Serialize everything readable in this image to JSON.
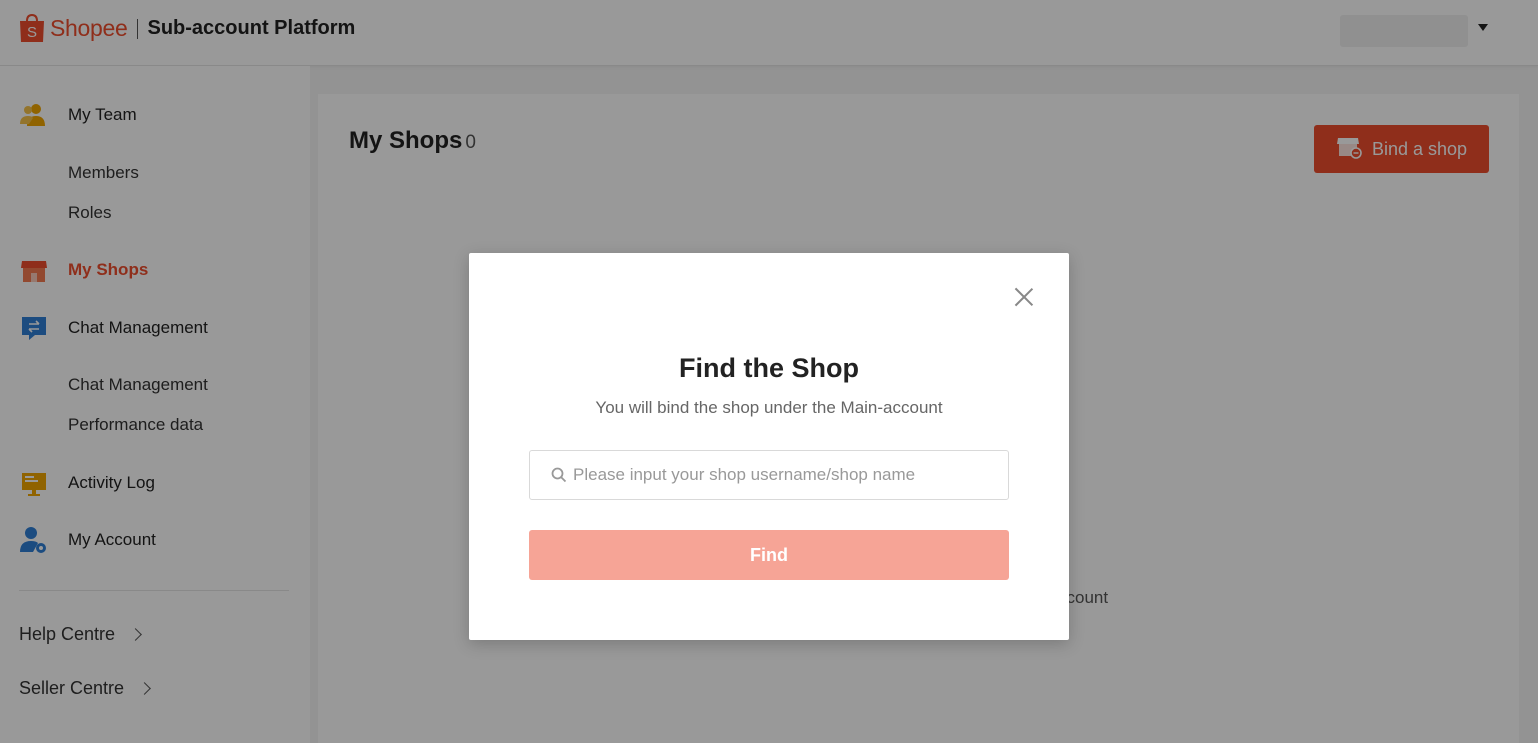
{
  "header": {
    "logo_text": "Shopee",
    "platform_name": "Sub-account Platform",
    "logo_icon": "shopee-bag-icon",
    "user_menu_icon": "caret-down-icon"
  },
  "sidebar": {
    "groups": [
      {
        "label": "My Team",
        "icon": "team-icon",
        "items": [
          "Members",
          "Roles"
        ]
      },
      {
        "label": "My Shops",
        "icon": "shop-icon",
        "active": true
      },
      {
        "label": "Chat Management",
        "icon": "chat-icon",
        "items": [
          "Chat Management",
          "Performance data"
        ]
      },
      {
        "label": "Activity Log",
        "icon": "activity-log-icon"
      },
      {
        "label": "My Account",
        "icon": "account-settings-icon"
      }
    ],
    "links": [
      "Help Centre",
      "Seller Centre"
    ]
  },
  "content": {
    "title": "My Shops",
    "count": "0",
    "bind_button": "Bind a shop",
    "empty_hint_fragment": "ccount"
  },
  "modal": {
    "title": "Find the Shop",
    "subtitle": "You will bind the shop under the Main-account",
    "search_placeholder": "Please input your shop username/shop name",
    "search_value": "",
    "find_button": "Find"
  },
  "colors": {
    "brand": "#ee4d2d",
    "find_button_disabled": "#f6a496",
    "overlay": "rgba(0,0,0,0.4)"
  }
}
